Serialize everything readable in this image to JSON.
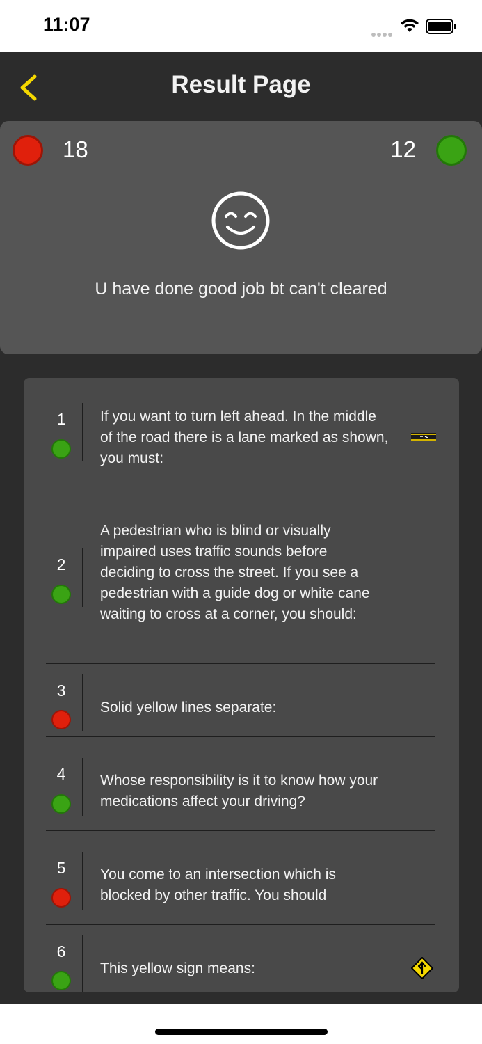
{
  "status_bar": {
    "time": "11:07"
  },
  "nav": {
    "title": "Result Page"
  },
  "summary": {
    "wrong_count": "18",
    "correct_count": "12",
    "message": "U have done good job bt can't cleared"
  },
  "colors": {
    "accent": "#f5d800",
    "wrong": "#e0200c",
    "correct": "#3aa314"
  },
  "questions": [
    {
      "number": "1",
      "status": "correct",
      "text": "If you want to turn left ahead. In the middle of the road there is a lane marked as shown, you must:",
      "has_image": true,
      "image_icon": "lane-marking-icon"
    },
    {
      "number": "2",
      "status": "correct",
      "text": "A pedestrian who is blind or visually impaired uses traffic sounds before deciding to cross the street. If you see a pedestrian with a guide dog or white cane waiting to cross at a corner, you should:",
      "has_image": false
    },
    {
      "number": "3",
      "status": "wrong",
      "text": "Solid yellow lines separate:",
      "has_image": false
    },
    {
      "number": "4",
      "status": "correct",
      "text": "Whose responsibility is it to know how your medications affect your driving?",
      "has_image": false
    },
    {
      "number": "5",
      "status": "wrong",
      "text": "You come to an intersection which is blocked by other traffic. You should",
      "has_image": false
    },
    {
      "number": "6",
      "status": "correct",
      "text": "This yellow sign means:",
      "has_image": true,
      "image_icon": "merge-sign-icon"
    }
  ]
}
